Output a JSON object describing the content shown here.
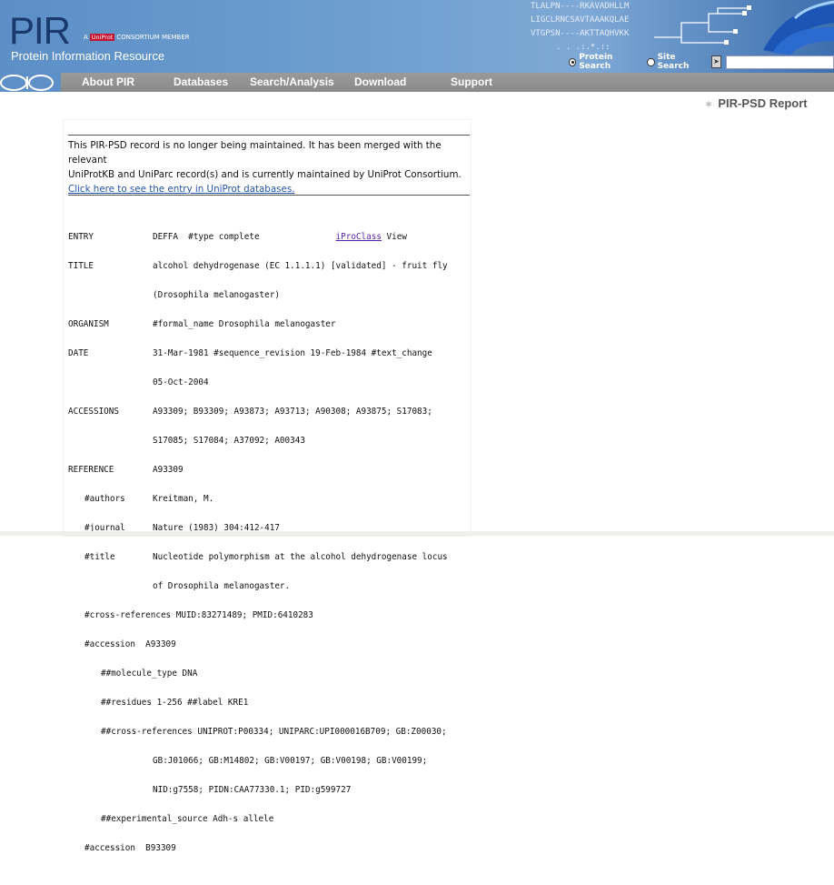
{
  "header": {
    "logo_text": "PIR",
    "tagline": "Protein Information Resource",
    "consortium_prefix": "A",
    "consortium_badge": "UniProt",
    "consortium_suffix": "CONSORTIUM MEMBER",
    "sequence_lines": [
      "TLALPN----RKAVADHLLM",
      "LIGCLRNCSAVTAAAKQLAE",
      "VTGPSN----AKTTAQHVKK",
      ".    .   .:.*.::"
    ],
    "search": {
      "option_protein": "Protein Search",
      "option_site": "Site Search",
      "selected": "Protein Search",
      "input_value": "",
      "go_icon": "arrow-right-icon"
    }
  },
  "nav": {
    "items": [
      "About PIR",
      "Databases",
      "Search/Analysis",
      "Download",
      "Support"
    ]
  },
  "page": {
    "report_title": "PIR-PSD Report"
  },
  "notice": {
    "line1": "This PIR-PSD record is no longer being maintained. It has been merged with the relevant",
    "line2": "UniProtKB and UniParc record(s) and is currently maintained by UniProt Consortium.",
    "link": "Click here to see the entry in UniProt databases."
  },
  "record": {
    "entry_label": "ENTRY",
    "entry_value": "DEFFA  #type complete",
    "iproclass_link": "iProClass",
    "iproclass_view": "View",
    "title_label": "TITLE",
    "title_line1": "alcohol dehydrogenase (EC 1.1.1.1) [validated] - fruit fly",
    "title_line2": "(Drosophila melanogaster)",
    "organism_label": "ORGANISM",
    "organism_value": "#formal_name Drosophila melanogaster",
    "date_label": "DATE",
    "date_line1": "31-Mar-1981 #sequence_revision 19-Feb-1984 #text_change",
    "date_line2": "05-Oct-2004",
    "accessions_label": "ACCESSIONS",
    "accessions_line1": "A93309; B93309; A93873; A93713; A90308; A93875; S17083;",
    "accessions_line2": "S17085; S17084; A37092; A00343",
    "reference_label": "REFERENCE",
    "reference_value": "A93309",
    "authors_label": "#authors",
    "authors_value": "Kreitman, M.",
    "journal_label": "#journal",
    "journal_value": "Nature (1983) 304:412-417",
    "ref_title_label": "#title",
    "ref_title_line1": "Nucleotide polymorphism at the alcohol dehydrogenase locus",
    "ref_title_line2": "of Drosophila melanogaster.",
    "crossref_line": "#cross-references MUID:83271489; PMID:6410283",
    "accession1_line": "#accession  A93309",
    "molecule_line": "##molecule_type DNA",
    "residues_line": "##residues 1-256 ##label KRE1",
    "xref_line1": "##cross-references UNIPROT:P00334; UNIPARC:UPI000016B709; GB:Z00030;",
    "xref_line2": "GB:J01066; GB:M14802; GB:V00197; GB:V00198; GB:V00199;",
    "xref_line3": "NID:g7558; PIDN:CAA77330.1; PID:g599727",
    "experimental_line": "##experimental_source Adh-s allele",
    "accession2_line": "#accession  B93309"
  }
}
